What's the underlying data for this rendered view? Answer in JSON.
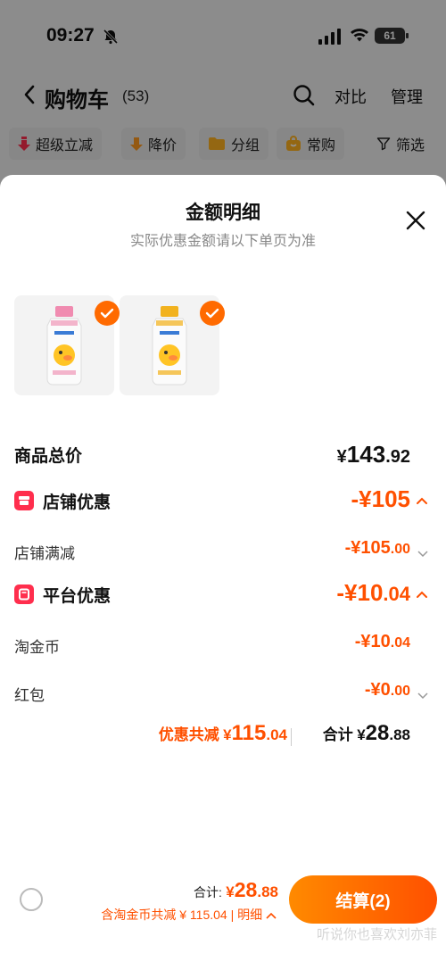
{
  "status_bar": {
    "time": "09:27",
    "battery": "61"
  },
  "nav": {
    "title": "购物车",
    "count": "(53)",
    "compare": "对比",
    "manage": "管理"
  },
  "filters": [
    "超级立减",
    "降价",
    "分组",
    "常购",
    "筛选"
  ],
  "sheet": {
    "title": "金额明细",
    "subtitle": "实际优惠金额请以下单页为准"
  },
  "products": [
    {
      "name": "粉色瓶装饮品",
      "checked": true
    },
    {
      "name": "黄色瓶装饮品",
      "checked": true
    }
  ],
  "breakdown": {
    "total_label": "商品总价",
    "total_cur": "¥",
    "total_int": "143",
    "total_dec": ".92",
    "shop_discount_label": "店铺优惠",
    "shop_discount_value": "-¥105",
    "shop_full_reduction_label": "店铺满减",
    "shop_full_reduction_int": "-¥105",
    "shop_full_reduction_dec": ".00",
    "platform_discount_label": "平台优惠",
    "platform_discount_int": "-¥10",
    "platform_discount_dec": ".04",
    "taojinbi_label": "淘金币",
    "taojinbi_int": "-¥10",
    "taojinbi_dec": ".04",
    "hongbao_label": "红包",
    "hongbao_int": "-¥0",
    "hongbao_dec": ".00"
  },
  "summary": {
    "discount_label": "优惠共减",
    "discount_cur": "¥",
    "discount_int": "115",
    "discount_dec": ".04",
    "total_label": "合计",
    "total_cur": "¥",
    "total_int": "28",
    "total_dec": ".88"
  },
  "footer": {
    "total_label": "合计:",
    "total_cur": "¥",
    "total_int": "28",
    "total_dec": ".88",
    "note": "含淘金币共减 ¥ 115.04 | 明细",
    "checkout": "结算(2)",
    "watermark": "听说你也喜欢刘亦菲"
  },
  "colors": {
    "accent": "#ff5000",
    "red_tag": "#ff2e4d",
    "check": "#ff6a00"
  }
}
